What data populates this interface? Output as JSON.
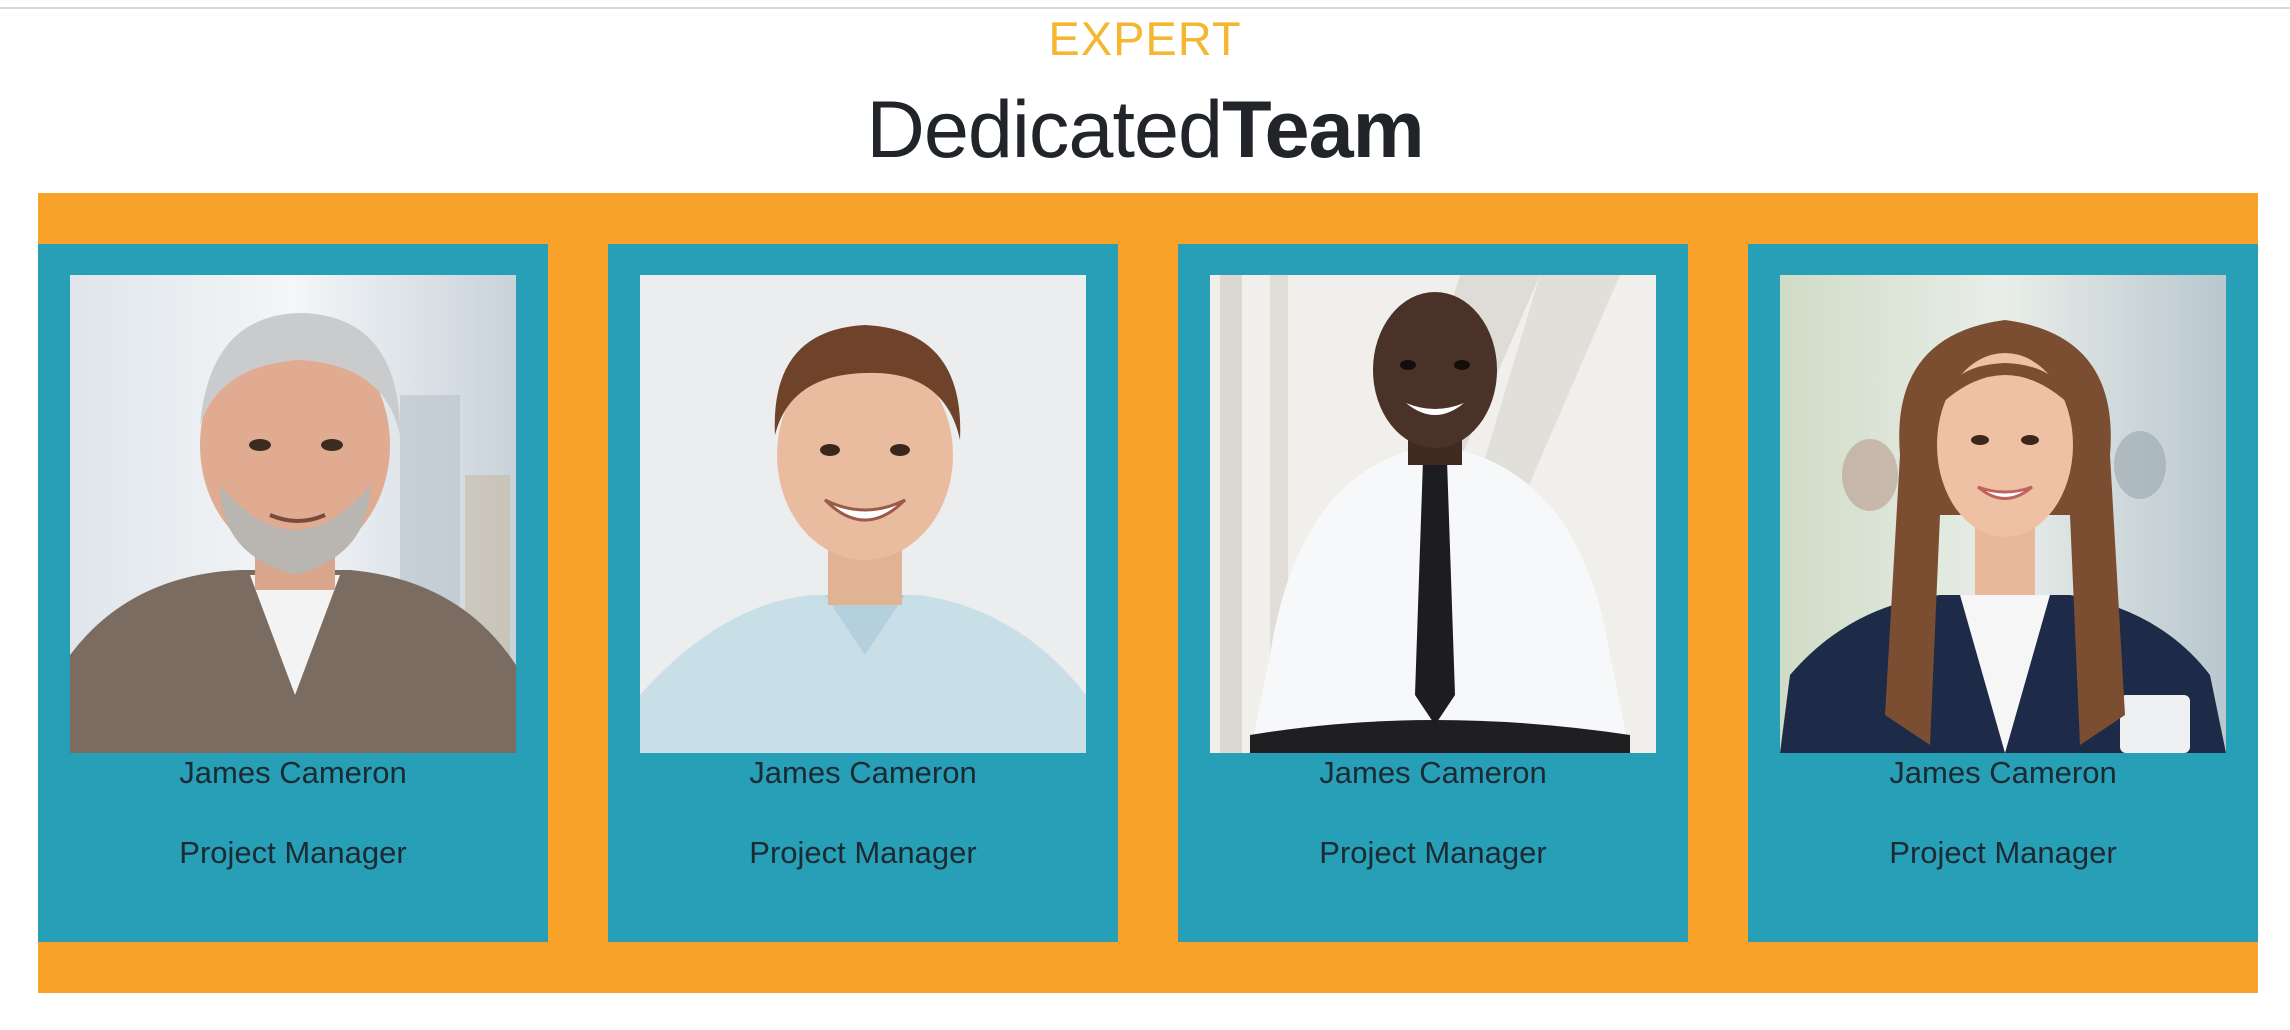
{
  "section": {
    "eyebrow": "EXPERT",
    "title_regular": "Dedicated",
    "title_bold": "Team"
  },
  "colors": {
    "eyebrow": "#f5b731",
    "band": "#f9a22a",
    "card": "#27a0b7",
    "text": "#212529"
  },
  "team": [
    {
      "name": "James Cameron",
      "role": "Project Manager",
      "photo": "portrait-photo"
    },
    {
      "name": "James Cameron",
      "role": "Project Manager",
      "photo": "portrait-photo"
    },
    {
      "name": "James Cameron",
      "role": "Project Manager",
      "photo": "portrait-photo"
    },
    {
      "name": "James Cameron",
      "role": "Project Manager",
      "photo": "portrait-photo"
    }
  ]
}
